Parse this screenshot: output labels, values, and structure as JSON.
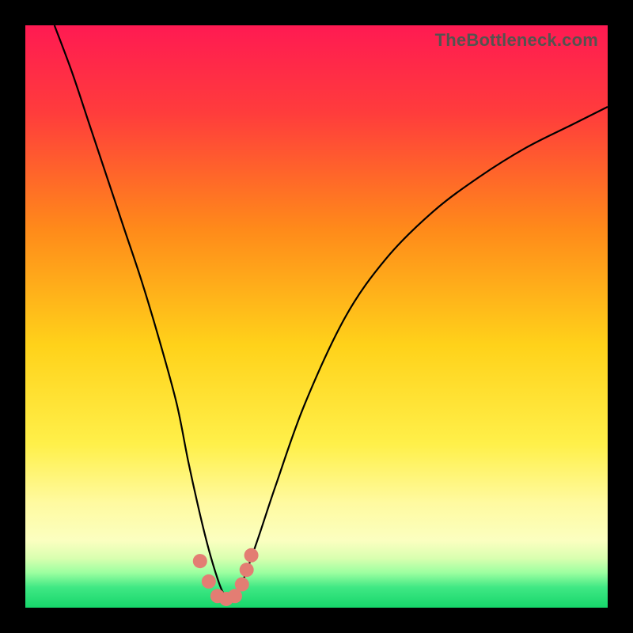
{
  "watermark": "TheBottleneck.com",
  "chart_data": {
    "type": "line",
    "title": "",
    "xlabel": "",
    "ylabel": "",
    "xlim": [
      0,
      100
    ],
    "ylim": [
      0,
      100
    ],
    "background_gradient": {
      "stops": [
        {
          "offset": 0.0,
          "color": "#ff1a52"
        },
        {
          "offset": 0.15,
          "color": "#ff3c3c"
        },
        {
          "offset": 0.35,
          "color": "#ff8a1a"
        },
        {
          "offset": 0.55,
          "color": "#ffd21a"
        },
        {
          "offset": 0.72,
          "color": "#fff04a"
        },
        {
          "offset": 0.82,
          "color": "#fffaa0"
        },
        {
          "offset": 0.885,
          "color": "#fbffc0"
        },
        {
          "offset": 0.915,
          "color": "#d9ffb0"
        },
        {
          "offset": 0.94,
          "color": "#9cffa0"
        },
        {
          "offset": 0.965,
          "color": "#40e884"
        },
        {
          "offset": 1.0,
          "color": "#16d66b"
        }
      ]
    },
    "series": [
      {
        "name": "bottleneck-curve",
        "color": "#000000",
        "x": [
          5,
          8,
          11,
          14,
          17,
          20,
          23,
          26,
          28,
          30,
          31.5,
          33,
          34,
          35,
          36,
          37.5,
          40,
          43,
          48,
          55,
          62,
          70,
          78,
          86,
          94,
          100
        ],
        "y": [
          100,
          92,
          83,
          74,
          65,
          56,
          46,
          35,
          25,
          16,
          10,
          5,
          2.5,
          1.5,
          2.5,
          5,
          12,
          21,
          35,
          50,
          60,
          68,
          74,
          79,
          83,
          86
        ]
      }
    ],
    "markers": {
      "name": "critical-points",
      "shape": "circle",
      "color": "#e37d73",
      "radius_px": 9,
      "points": [
        {
          "x": 30.0,
          "y": 8.0
        },
        {
          "x": 31.5,
          "y": 4.5
        },
        {
          "x": 33.0,
          "y": 2.0
        },
        {
          "x": 34.5,
          "y": 1.5
        },
        {
          "x": 36.0,
          "y": 2.0
        },
        {
          "x": 37.2,
          "y": 4.0
        },
        {
          "x": 38.0,
          "y": 6.5
        },
        {
          "x": 38.8,
          "y": 9.0
        }
      ]
    }
  }
}
